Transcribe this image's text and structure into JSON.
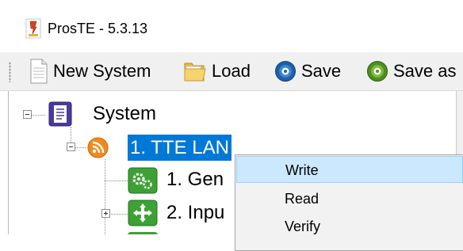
{
  "window": {
    "title": "ProsTE - 5.3.13",
    "icon": "app-icon"
  },
  "toolbar": {
    "new_system": {
      "label": "New System",
      "icon": "document-icon"
    },
    "load": {
      "label": "Load",
      "icon": "folder-icon"
    },
    "save": {
      "label": "Save",
      "icon": "save-disc-icon"
    },
    "save_as": {
      "label": "Save as",
      "icon": "save-as-disc-icon"
    }
  },
  "tree": {
    "root": {
      "label": "System",
      "icon": "system-document-icon",
      "expanded": true
    },
    "lan": {
      "label": "1. TTE LAN",
      "icon": "rss-feed-icon",
      "expanded": true,
      "selected": true
    },
    "general": {
      "label": "1. Gen",
      "icon": "gears-icon"
    },
    "inputs": {
      "label": "2. Inpu",
      "icon": "move-arrows-icon",
      "expanded": false
    }
  },
  "context_menu": {
    "items": [
      {
        "label": "Write",
        "highlighted": true
      },
      {
        "label": "Read"
      },
      {
        "label": "Verify"
      }
    ]
  },
  "colors": {
    "selection": "#0078d7",
    "menu_highlight": "#cce8ff",
    "toolbar_bg": "#f0f0f0"
  }
}
